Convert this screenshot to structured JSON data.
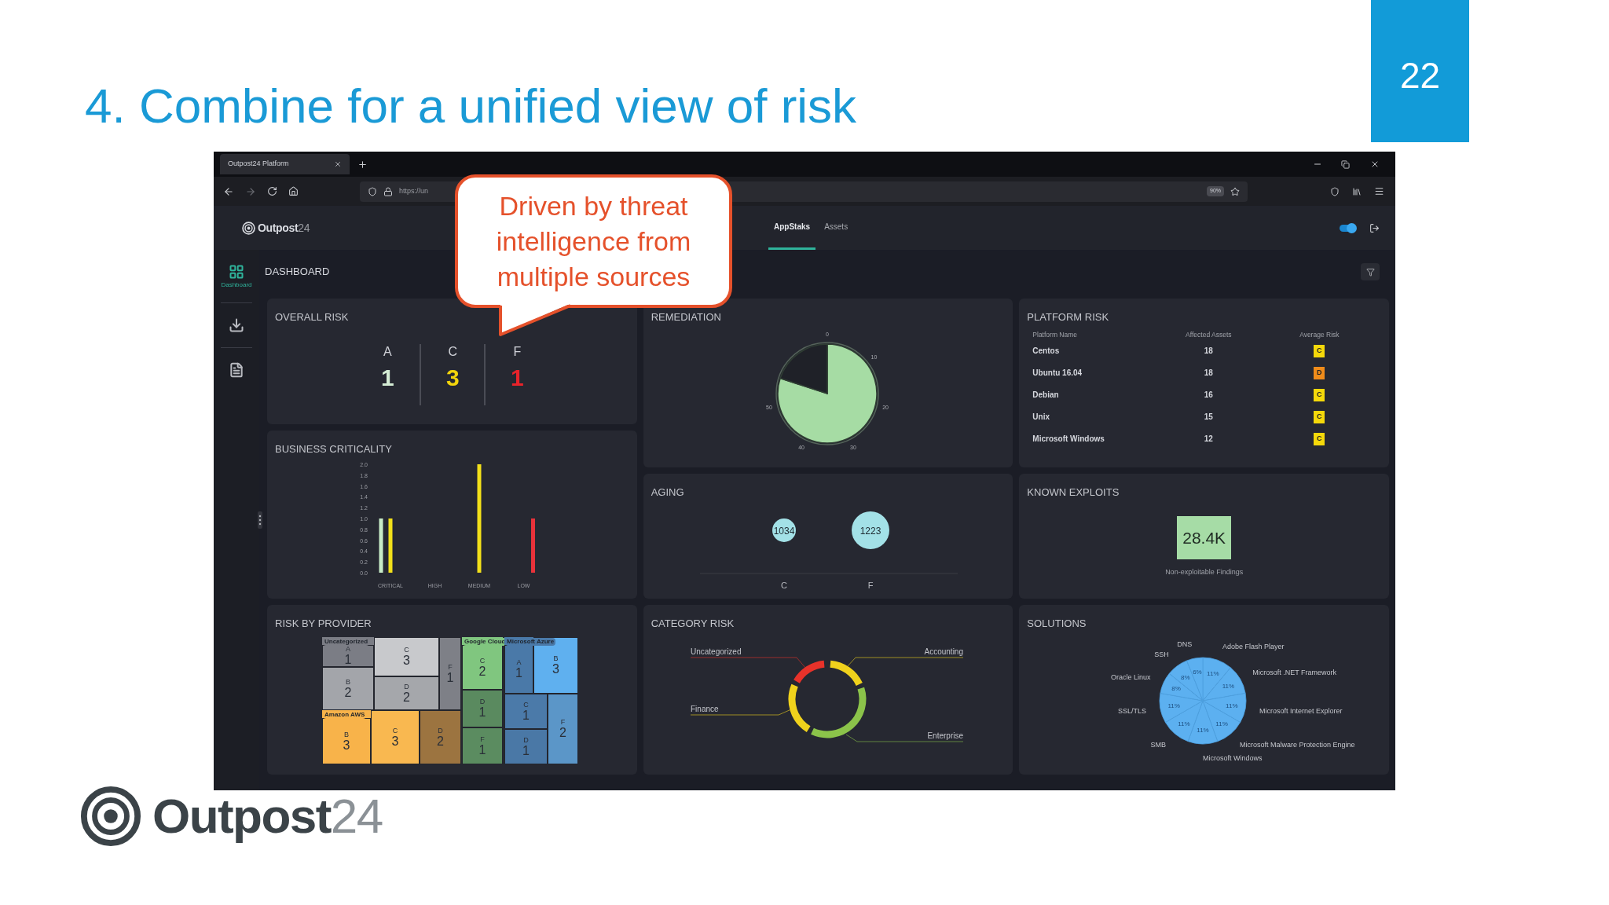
{
  "slide": {
    "title": "4. Combine for a unified view of risk",
    "page_number": "22",
    "logo": {
      "name": "Outpost",
      "suffix": "24"
    }
  },
  "callout": {
    "text": "Driven by threat intelligence from multiple sources"
  },
  "browser": {
    "tab_title": "Outpost24 Platform",
    "url": "https://un",
    "zoom": "90%"
  },
  "app": {
    "logo": {
      "name": "Outpost",
      "suffix": "24"
    },
    "tabs": [
      {
        "label": "AppStaks",
        "selected": true
      },
      {
        "label": "Assets",
        "selected": false
      }
    ],
    "toggle": {
      "on": true
    }
  },
  "sidebar": {
    "items": [
      {
        "kind": "dashboard",
        "label": "Dashboard",
        "selected": true
      },
      {
        "kind": "download",
        "selected": false
      },
      {
        "kind": "report",
        "selected": false
      }
    ]
  },
  "dashboard_title": "DASHBOARD",
  "overall_risk": {
    "title": "OVERALL RISK",
    "grades": [
      {
        "grade": "A",
        "count": "1",
        "color": "#d4ecd4"
      },
      {
        "grade": "C",
        "count": "3",
        "color": "#f2d40c"
      },
      {
        "grade": "F",
        "count": "1",
        "color": "#e8232a"
      }
    ]
  },
  "business_criticality": {
    "title": "BUSINESS CRITICALITY",
    "chart_data": {
      "type": "bar",
      "categories": [
        "CRITICAL",
        "HIGH",
        "MEDIUM",
        "LOW"
      ],
      "series": [
        {
          "color": "#c8ecc8",
          "values": [
            1,
            null,
            null,
            null
          ]
        },
        {
          "color": "#f2e01a",
          "values": [
            1,
            null,
            2,
            null
          ]
        },
        {
          "color": "#e8323a",
          "values": [
            null,
            null,
            null,
            1
          ]
        }
      ],
      "ylim": [
        0,
        2
      ],
      "yticks": [
        {
          "value": 0,
          "label": "0.0"
        },
        {
          "value": 0.2,
          "label": "0.2"
        },
        {
          "value": 0.4,
          "label": "0.4"
        },
        {
          "value": 0.6,
          "label": "0.6"
        },
        {
          "value": 0.8,
          "label": "0.8"
        },
        {
          "value": 1,
          "label": "1.0"
        },
        {
          "value": 1.2,
          "label": "1.2"
        },
        {
          "value": 1.4,
          "label": "1.4"
        },
        {
          "value": 1.6,
          "label": "1.6"
        },
        {
          "value": 1.8,
          "label": "1.8"
        },
        {
          "value": 2,
          "label": "2.0"
        }
      ]
    }
  },
  "risk_by_provider": {
    "title": "RISK BY PROVIDER",
    "groups": [
      {
        "name": "Uncategorized",
        "cells": [
          {
            "grade": "A",
            "count": "1",
            "color": "#7b7d85"
          },
          {
            "grade": "B",
            "count": "2",
            "color": "#a3a5aa"
          },
          {
            "grade": "C",
            "count": "3",
            "color": "#c8c9cc"
          },
          {
            "grade": "D",
            "count": "2",
            "color": "#a5a7ab"
          },
          {
            "grade": "F",
            "count": "1",
            "color": "#7e8087"
          }
        ]
      },
      {
        "name": "Amazon AWS",
        "cells": [
          {
            "grade": "B",
            "count": "3",
            "color": "#f8b34a"
          },
          {
            "grade": "C",
            "count": "3",
            "color": "#f9b850"
          },
          {
            "grade": "D",
            "count": "2",
            "color": "#9c7440"
          }
        ]
      },
      {
        "name": "Google Cloud",
        "cells": [
          {
            "grade": "C",
            "count": "2",
            "color": "#80c67f"
          },
          {
            "grade": "D",
            "count": "1",
            "color": "#5a8a5f"
          },
          {
            "grade": "F",
            "count": "1",
            "color": "#5b8c60"
          }
        ]
      },
      {
        "name": "Microsoft Azure",
        "cells": [
          {
            "grade": "A",
            "count": "1",
            "color": "#4a79a8"
          },
          {
            "grade": "B",
            "count": "3",
            "color": "#5fb0ef"
          },
          {
            "grade": "C",
            "count": "1",
            "color": "#4b7aa9"
          },
          {
            "grade": "D",
            "count": "1",
            "color": "#4a78a6"
          },
          {
            "grade": "F",
            "count": "2",
            "color": "#5b96c8"
          }
        ]
      }
    ]
  },
  "remediation": {
    "title": "REMEDIATION",
    "ticks": [
      "0",
      "10",
      "20",
      "30",
      "40",
      "50"
    ],
    "chart_data": {
      "type": "pie",
      "values": [
        80,
        20
      ]
    }
  },
  "aging": {
    "title": "AGING",
    "bubbles": [
      {
        "label": "C",
        "value": "1034",
        "kind": "small"
      },
      {
        "label": "F",
        "value": "1223",
        "kind": "large"
      }
    ]
  },
  "category_risk": {
    "title": "CATEGORY RISK",
    "segments": [
      {
        "label": "Uncategorized",
        "color": "#e8322a"
      },
      {
        "label": "Accounting",
        "color": "#f0d21c"
      },
      {
        "label": "Finance",
        "color": "#f0d21c"
      },
      {
        "label": "Enterprise",
        "color": "#8bc34a"
      }
    ]
  },
  "platform_risk": {
    "title": "PLATFORM RISK",
    "columns": [
      "Platform Name",
      "Affected Assets",
      "Average Risk"
    ],
    "rows": [
      {
        "name": "Centos",
        "assets": "18",
        "risk": "C",
        "color": "#f5d90a"
      },
      {
        "name": "Ubuntu 16.04",
        "assets": "18",
        "risk": "D",
        "color": "#f08c1a"
      },
      {
        "name": "Debian",
        "assets": "16",
        "risk": "C",
        "color": "#f5d90a"
      },
      {
        "name": "Unix",
        "assets": "15",
        "risk": "C",
        "color": "#f5d90a"
      },
      {
        "name": "Microsoft Windows",
        "assets": "12",
        "risk": "C",
        "color": "#f5d90a"
      }
    ]
  },
  "known_exploits": {
    "title": "KNOWN EXPLOITS",
    "value": "28.4K",
    "caption": "Non-exploitable Findings"
  },
  "solutions": {
    "title": "SOLUTIONS",
    "chart_data": {
      "type": "pie",
      "categories": [
        "Adobe Flash Player",
        "Microsoft .NET Framework",
        "Microsoft Internet Explorer",
        "Microsoft Malware Protection Engine",
        "Microsoft Windows",
        "SMB",
        "SSL/TLS",
        "Oracle Linux",
        "SSH",
        "DNS"
      ],
      "values": [
        11,
        11,
        11,
        11,
        11,
        11,
        11,
        8,
        8,
        6
      ],
      "data_labels": true,
      "value_labels": [
        "11%",
        "11%",
        "11%",
        "11%",
        "11%",
        "11%",
        "11%",
        "8%",
        "8%",
        "6%"
      ]
    }
  }
}
